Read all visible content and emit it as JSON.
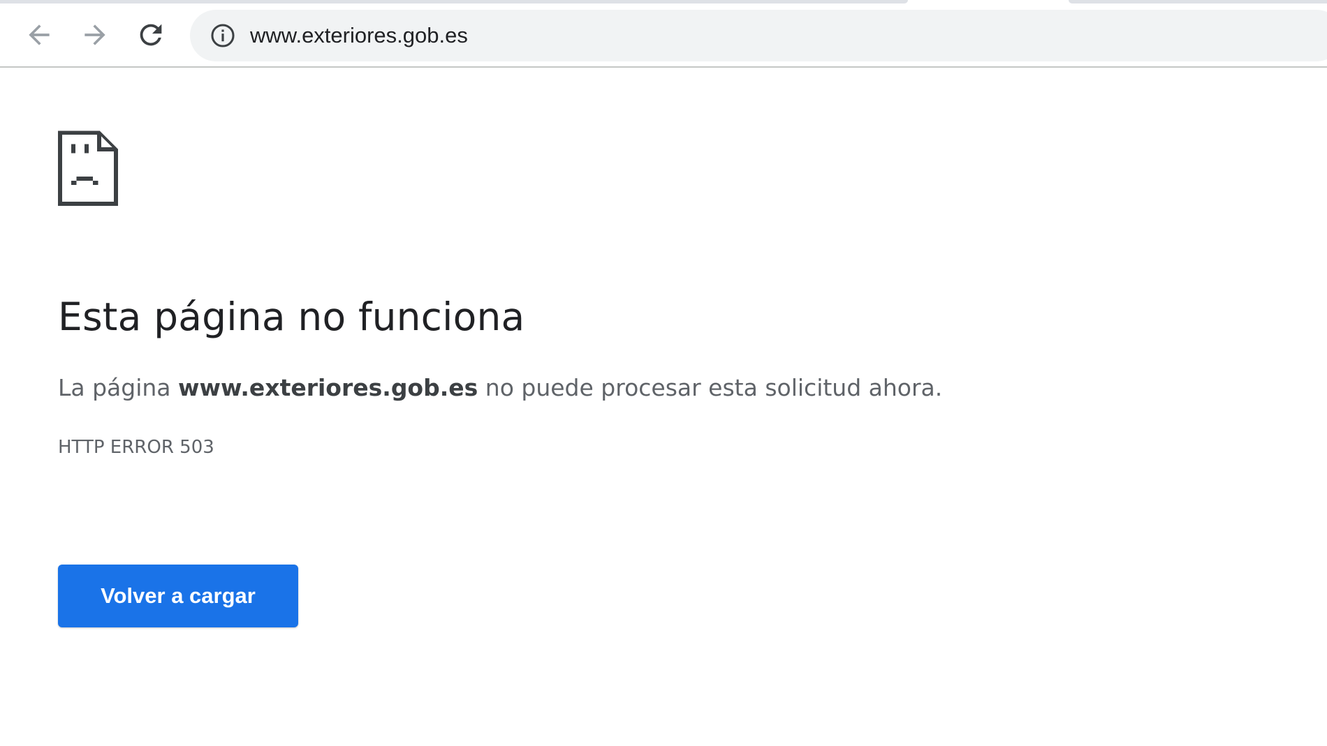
{
  "browser": {
    "url": "www.exteriores.gob.es",
    "icons": {
      "back": "back-arrow-icon",
      "forward": "forward-arrow-icon",
      "reload": "reload-icon",
      "site_info": "info-icon"
    }
  },
  "error_page": {
    "icon": "sad-page-icon",
    "title": "Esta página no funciona",
    "description_prefix": "La página ",
    "description_host": "www.exteriores.gob.es",
    "description_suffix": " no puede procesar esta solicitud ahora.",
    "error_code": "HTTP ERROR 503",
    "reload_label": "Volver a cargar"
  },
  "colors": {
    "button": "#1a73e8",
    "title": "#202124",
    "body_text": "#5f6368",
    "omnibox": "#f1f3f4"
  }
}
